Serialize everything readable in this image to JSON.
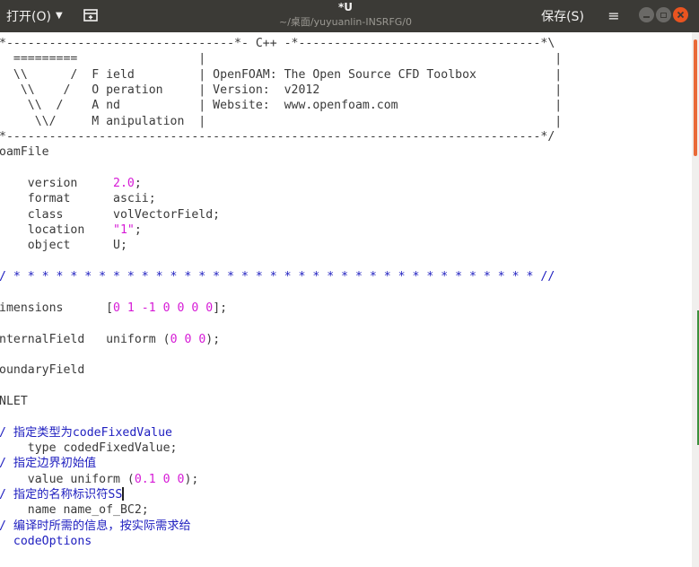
{
  "header": {
    "open_label": "打开(O)",
    "title": "*U",
    "path": "~/桌面/yuyuanlin-INSRFG/0",
    "save_label": "保存(S)"
  },
  "colors": {
    "header_bg": "#3b3a36",
    "accent_close": "#e95420",
    "string_color": "#d61ad6",
    "comment_color": "#2020c0"
  },
  "editor": {
    "lines": [
      [
        {
          "t": "*--------------------------------*- C++ -*----------------------------------*\\",
          "c": "def"
        }
      ],
      [
        {
          "t": "  =========                 |                                                 |",
          "c": "def"
        }
      ],
      [
        {
          "t": "  \\\\      /  F ield         | OpenFOAM: The Open Source CFD Toolbox           |",
          "c": "def"
        }
      ],
      [
        {
          "t": "   \\\\    /   O peration     | Version:  v2012                                 |",
          "c": "def"
        }
      ],
      [
        {
          "t": "    \\\\  /    A nd           | Website:  www.openfoam.com                      |",
          "c": "def"
        }
      ],
      [
        {
          "t": "     \\\\/     M anipulation  |                                                 |",
          "c": "def"
        }
      ],
      [
        {
          "t": "*---------------------------------------------------------------------------*/",
          "c": "def"
        }
      ],
      [
        {
          "t": "oamFile",
          "c": "def"
        }
      ],
      [
        {
          "t": "",
          "c": "def"
        }
      ],
      [
        {
          "t": "    version     ",
          "c": "def"
        },
        {
          "t": "2.0",
          "c": "num"
        },
        {
          "t": ";",
          "c": "def"
        }
      ],
      [
        {
          "t": "    format      ascii;",
          "c": "def"
        }
      ],
      [
        {
          "t": "    class       volVectorField;",
          "c": "def"
        }
      ],
      [
        {
          "t": "    location    ",
          "c": "def"
        },
        {
          "t": "\"1\"",
          "c": "str"
        },
        {
          "t": ";",
          "c": "def"
        }
      ],
      [
        {
          "t": "    object      U;",
          "c": "def"
        }
      ],
      [
        {
          "t": "",
          "c": "def"
        }
      ],
      [
        {
          "t": "/ * * * * * * * * * * * * * * * * * * * * * * * * * * * * * * * * * * * * * //",
          "c": "cmt"
        }
      ],
      [
        {
          "t": "",
          "c": "def"
        }
      ],
      [
        {
          "t": "imensions      [",
          "c": "def"
        },
        {
          "t": "0 1 -1 0 0 0 0",
          "c": "num"
        },
        {
          "t": "];",
          "c": "def"
        }
      ],
      [
        {
          "t": "",
          "c": "def"
        }
      ],
      [
        {
          "t": "nternalField   uniform (",
          "c": "def"
        },
        {
          "t": "0 0 0",
          "c": "num"
        },
        {
          "t": ");",
          "c": "def"
        }
      ],
      [
        {
          "t": "",
          "c": "def"
        }
      ],
      [
        {
          "t": "oundaryField",
          "c": "def"
        }
      ],
      [
        {
          "t": "",
          "c": "def"
        }
      ],
      [
        {
          "t": "NLET",
          "c": "def"
        }
      ],
      [
        {
          "t": "",
          "c": "def"
        }
      ],
      [
        {
          "t": "/ ",
          "c": "cmt"
        },
        {
          "t": "指定类型为",
          "c": "cjk"
        },
        {
          "t": "codeFixedValue",
          "c": "cmt"
        }
      ],
      [
        {
          "t": "    type codedFixedValue;",
          "c": "def"
        }
      ],
      [
        {
          "t": "/ ",
          "c": "cmt"
        },
        {
          "t": "指定边界初始值",
          "c": "cjk"
        }
      ],
      [
        {
          "t": "    value uniform (",
          "c": "def"
        },
        {
          "t": "0.1 0 0",
          "c": "num"
        },
        {
          "t": ");",
          "c": "def"
        }
      ],
      [
        {
          "t": "/ ",
          "c": "cmt"
        },
        {
          "t": "指定的名称标识符",
          "c": "cjk"
        },
        {
          "t": "SS",
          "c": "cmt"
        },
        {
          "t": "",
          "c": "cursor"
        }
      ],
      [
        {
          "t": "    name name_of_BC2;",
          "c": "def"
        }
      ],
      [
        {
          "t": "/ ",
          "c": "cmt"
        },
        {
          "t": "编译时所需的信息，按实际需求给",
          "c": "cjk"
        }
      ],
      [
        {
          "t": "  codeOptions",
          "c": "cmt"
        }
      ]
    ]
  }
}
